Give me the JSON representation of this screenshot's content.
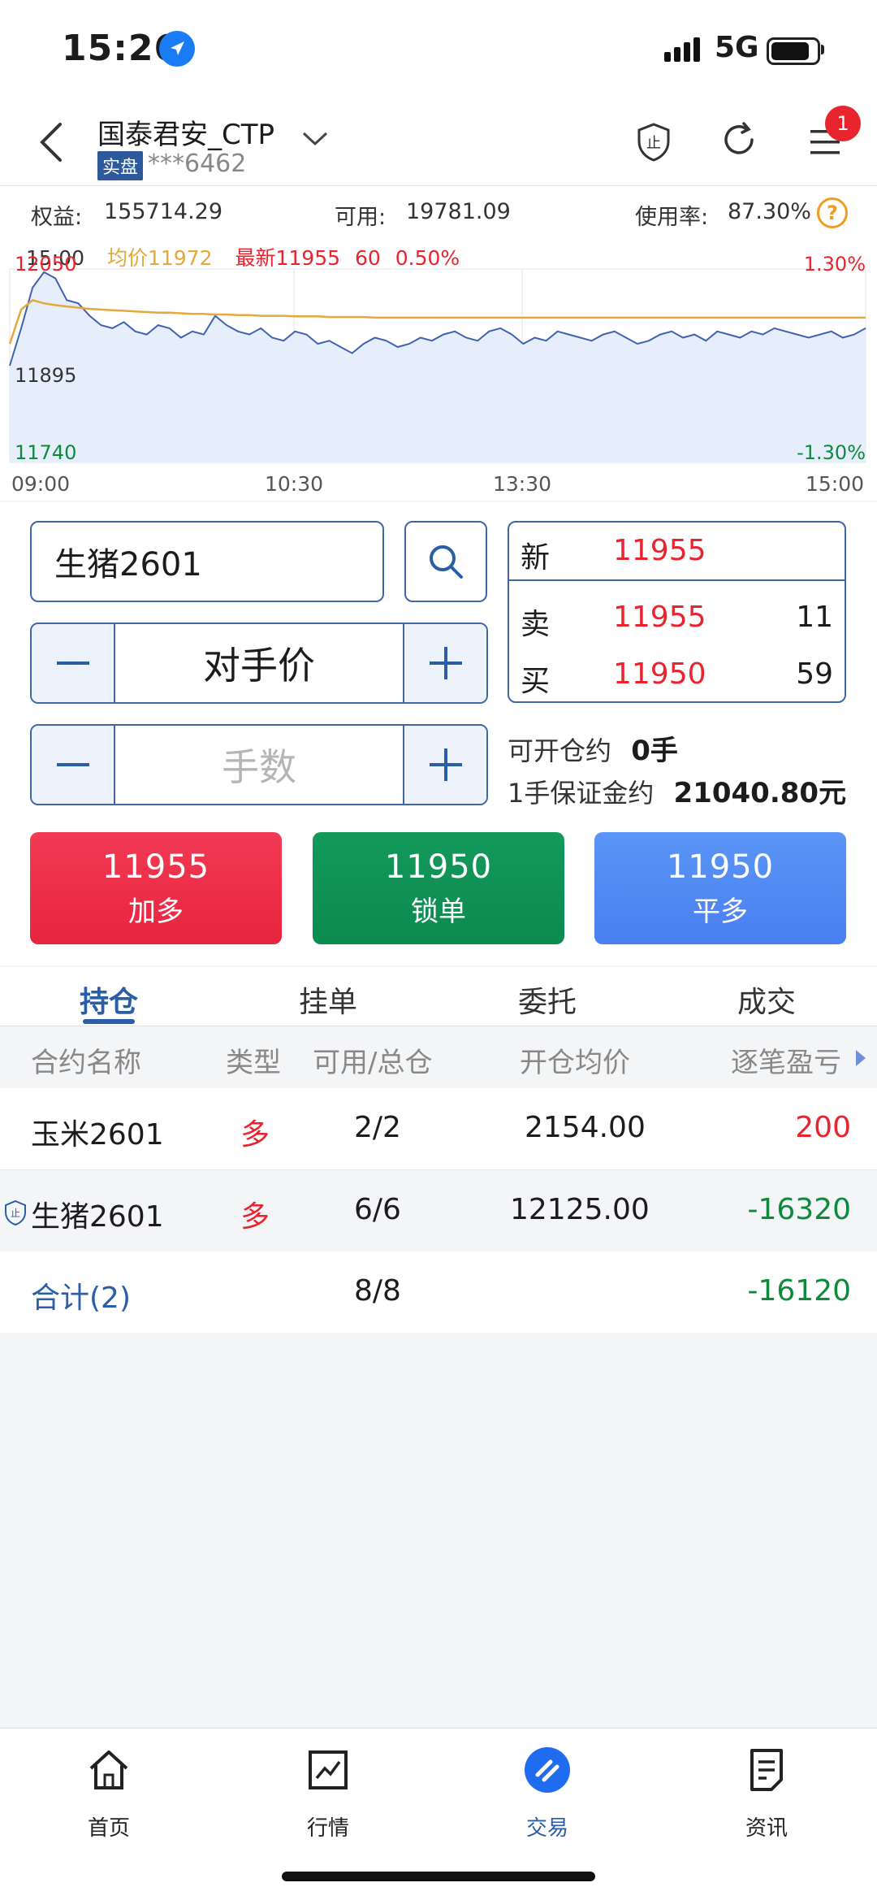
{
  "status_bar": {
    "time": "15:26",
    "network": "5G"
  },
  "header": {
    "account_name": "国泰君安_CTP",
    "account_type_badge": "实盘",
    "account_number": "***6462",
    "notification_count": "1"
  },
  "summary": {
    "equity_label": "权益:",
    "equity_value": "155714.29",
    "available_label": "可用:",
    "available_value": "19781.09",
    "usage_label": "使用率:",
    "usage_value": "87.30%",
    "help_icon": "?"
  },
  "chart_info": {
    "time": "15:00",
    "avg_label": "均价11972",
    "latest_label": "最新11955",
    "change": "60",
    "change_pct": "0.50%"
  },
  "chart_data": {
    "type": "line",
    "x_ticks": [
      "09:00",
      "10:30",
      "13:30",
      "15:00"
    ],
    "y_ticks": [
      "12050",
      "11895",
      "11740"
    ],
    "pct_ticks": [
      "1.30%",
      "-1.30%"
    ],
    "ylim": [
      11740,
      12050
    ],
    "series": [
      {
        "color": "#3f63b0",
        "values": [
          11895,
          11955,
          12020,
          12045,
          12035,
          12000,
          11995,
          11975,
          11960,
          11955,
          11965,
          11950,
          11945,
          11960,
          11955,
          11940,
          11950,
          11945,
          11975,
          11960,
          11950,
          11945,
          11955,
          11940,
          11935,
          11950,
          11945,
          11930,
          11935,
          11925,
          11915,
          11930,
          11940,
          11935,
          11925,
          11930,
          11940,
          11935,
          11945,
          11950,
          11940,
          11935,
          11950,
          11955,
          11945,
          11930,
          11940,
          11935,
          11950,
          11945,
          11940,
          11935,
          11945,
          11950,
          11940,
          11930,
          11935,
          11945,
          11950,
          11940,
          11945,
          11935,
          11950,
          11945,
          11940,
          11950,
          11945,
          11955,
          11950,
          11945,
          11940,
          11945,
          11950,
          11940,
          11945,
          11955
        ]
      },
      {
        "color": "#e5a93a",
        "values": [
          11930,
          11985,
          12000,
          11995,
          11992,
          11990,
          11988,
          11986,
          11985,
          11984,
          11983,
          11982,
          11981,
          11980,
          11980,
          11979,
          11978,
          11978,
          11977,
          11977,
          11976,
          11976,
          11975,
          11975,
          11975,
          11974,
          11974,
          11974,
          11973,
          11973,
          11973,
          11973,
          11972,
          11972,
          11972,
          11972,
          11972,
          11972,
          11972,
          11972,
          11972,
          11972,
          11972,
          11972,
          11972,
          11972,
          11972,
          11972,
          11972,
          11972,
          11972,
          11972,
          11972,
          11972,
          11972,
          11972,
          11972,
          11972,
          11972,
          11972,
          11972,
          11972,
          11972,
          11972,
          11972,
          11972,
          11972,
          11972,
          11972,
          11972,
          11972,
          11972,
          11972,
          11972,
          11972,
          11972
        ]
      }
    ]
  },
  "order_form": {
    "symbol": "生猪2601",
    "price_type": "对手价",
    "qty_placeholder": "手数"
  },
  "quote": {
    "last_label": "新",
    "last_price": "11955",
    "ask_label": "卖",
    "ask_price": "11955",
    "ask_vol": "11",
    "bid_label": "买",
    "bid_price": "11950",
    "bid_vol": "59"
  },
  "open_info": {
    "open_label": "可开仓约",
    "open_value": "0手",
    "margin_label": "1手保证金约",
    "margin_value": "21040.80元"
  },
  "trade_buttons": [
    {
      "price": "11955",
      "label": "加多",
      "color": "#ef2f49"
    },
    {
      "price": "11950",
      "label": "锁单",
      "color": "#0f9156"
    },
    {
      "price": "11950",
      "label": "平多",
      "color": "#4a86f2"
    }
  ],
  "tabs": [
    "持仓",
    "挂单",
    "委托",
    "成交"
  ],
  "table": {
    "headers": [
      "合约名称",
      "类型",
      "可用/总仓",
      "开仓均价",
      "逐笔盈亏"
    ],
    "rows": [
      {
        "name": "玉米2601",
        "type": "多",
        "avail": "2/2",
        "avg": "2154.00",
        "pnl": "200"
      },
      {
        "name": "生猪2601",
        "type": "多",
        "avail": "6/6",
        "avg": "12125.00",
        "pnl": "-16320"
      }
    ],
    "total": {
      "label": "合计(2)",
      "avail": "8/8",
      "pnl": "-16120"
    }
  },
  "nav": [
    {
      "label": "首页",
      "icon": "home-icon"
    },
    {
      "label": "行情",
      "icon": "chart-icon"
    },
    {
      "label": "交易",
      "icon": "trade-icon"
    },
    {
      "label": "资讯",
      "icon": "news-icon"
    }
  ]
}
